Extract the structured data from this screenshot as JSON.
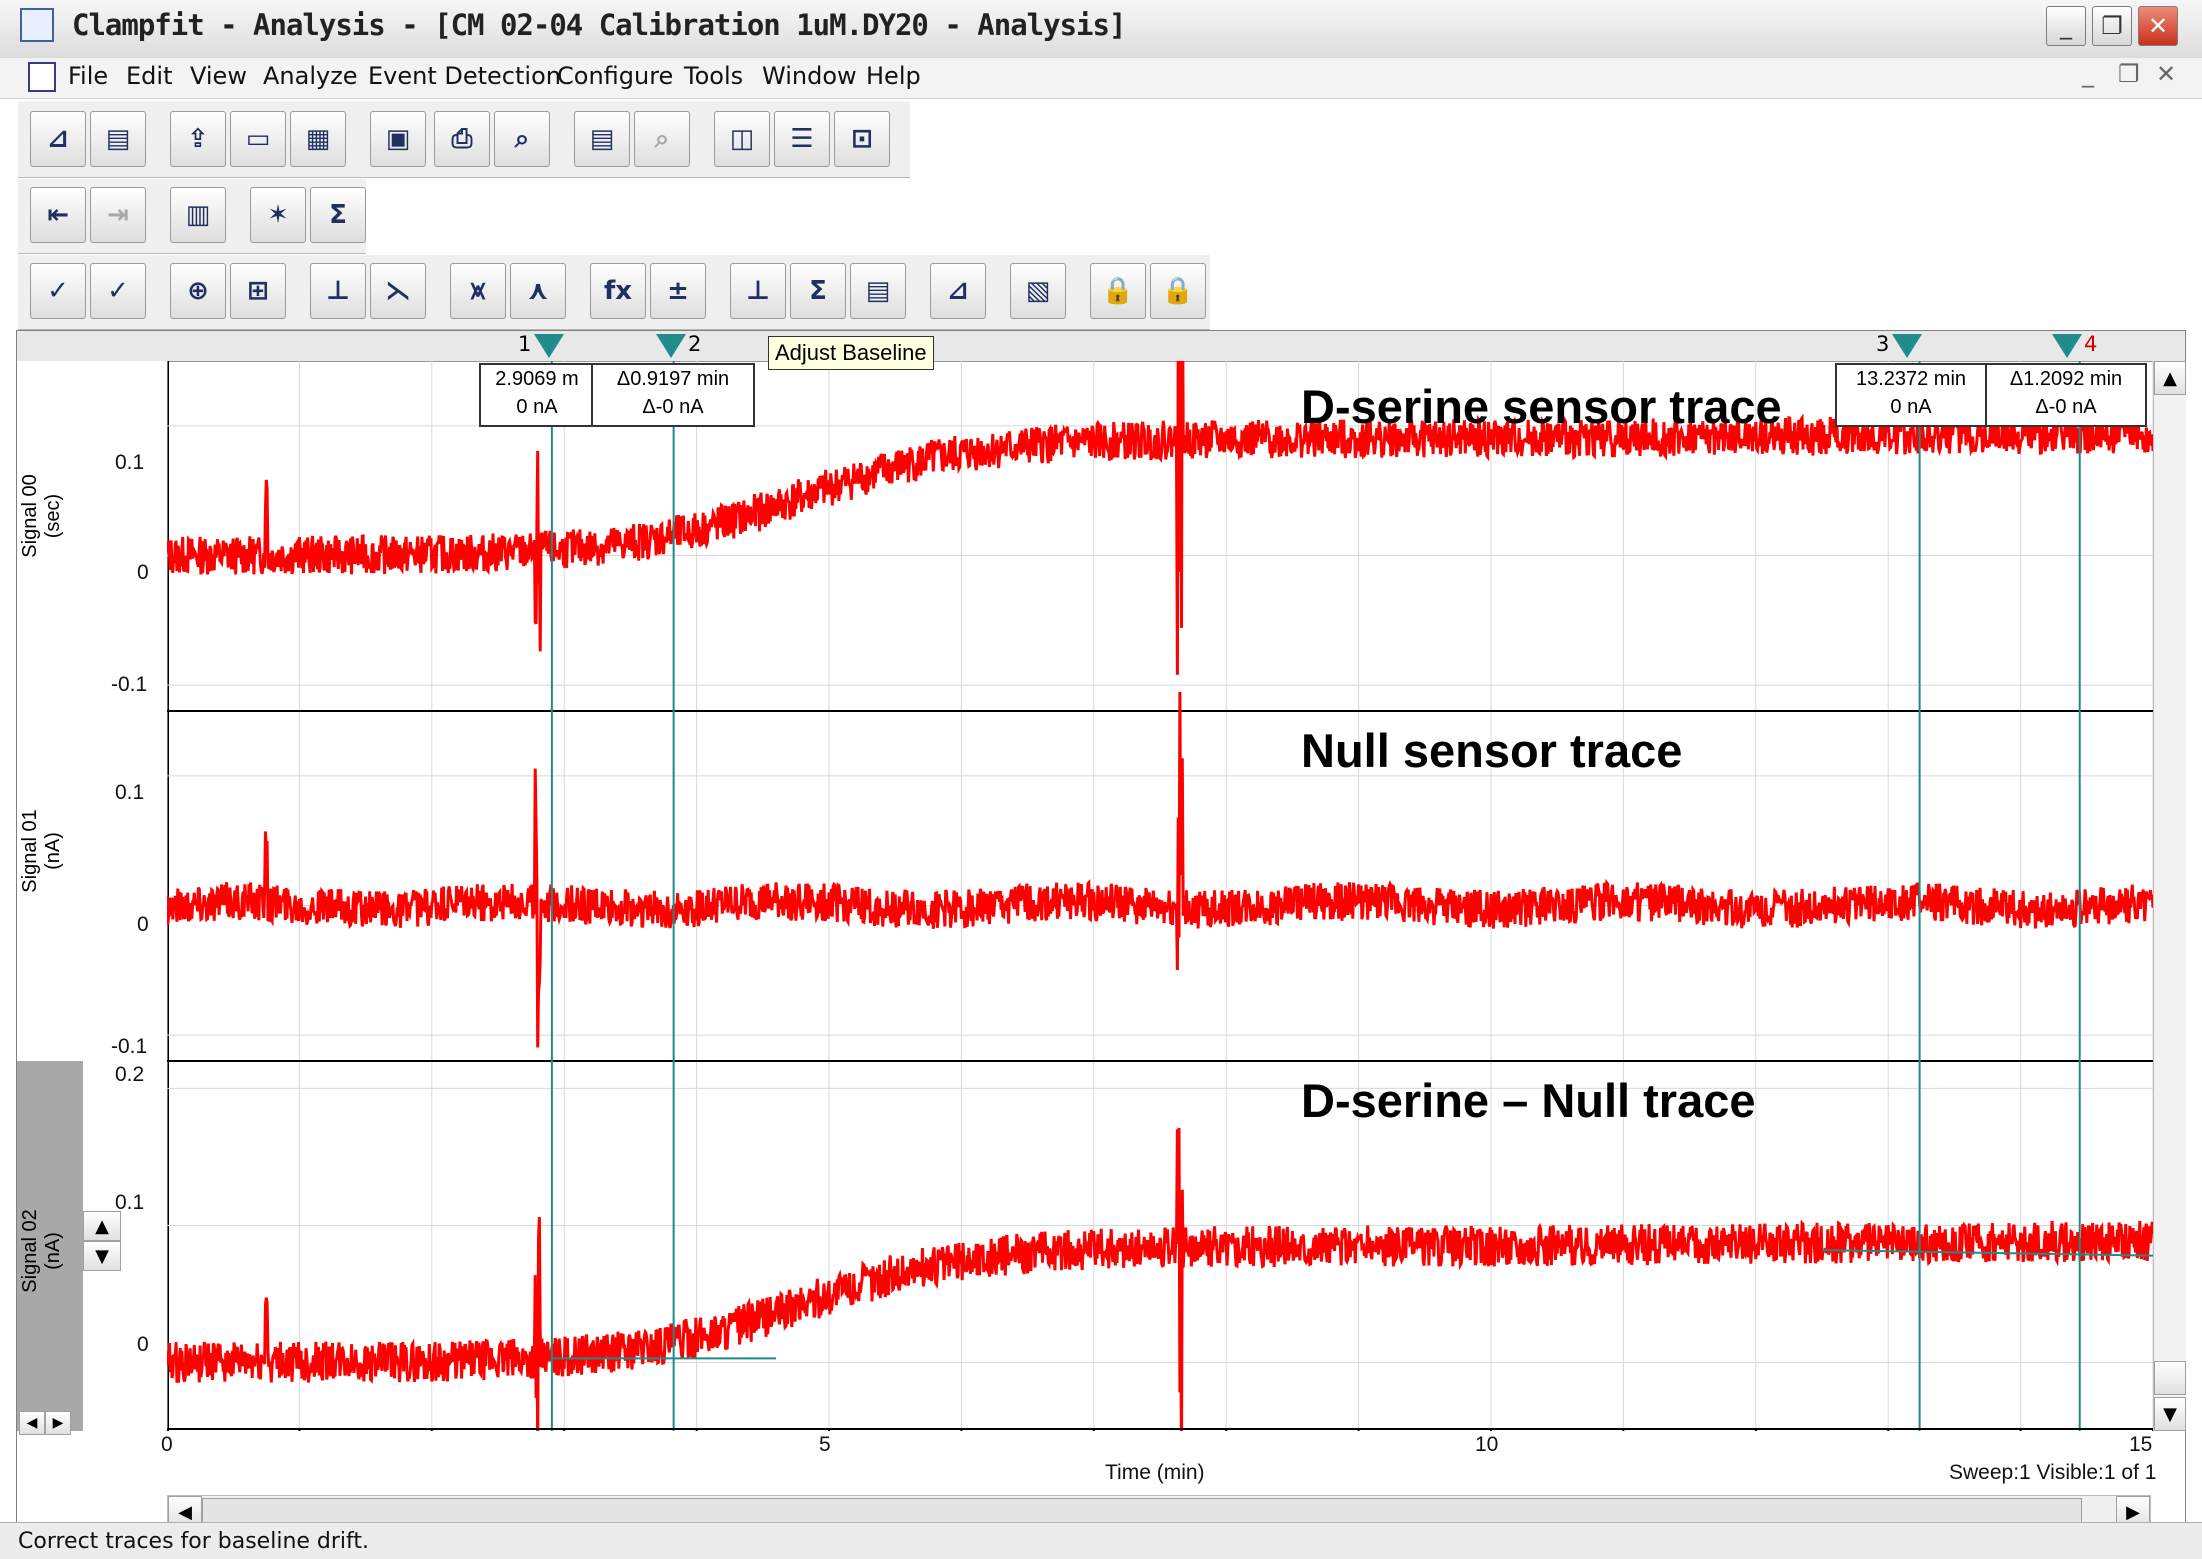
{
  "window": {
    "title": "Clampfit - Analysis - [CM 02-04 Calibration 1uM.DY20 - Analysis]",
    "icon": "clampfit-app-icon"
  },
  "menu": [
    "File",
    "Edit",
    "View",
    "Analyze",
    "Event Detection",
    "Configure",
    "Tools",
    "Window",
    "Help"
  ],
  "tooltip": "Adjust Baseline",
  "cursors": [
    {
      "num": "1",
      "time_min": 2.9069
    },
    {
      "num": "2",
      "time_min": 3.8266
    },
    {
      "num": "3",
      "time_min": 13.2372
    },
    {
      "num": "4",
      "time_min": 14.4464
    }
  ],
  "readouts": {
    "c1": {
      "line1": "2.9069 m",
      "line2": "0 nA"
    },
    "c2": {
      "line1": "Δ0.9197 min",
      "line2": "Δ-0 nA"
    },
    "c3": {
      "line1": "13.2372 min",
      "line2": "0 nA"
    },
    "c4": {
      "line1": "Δ1.2092 min",
      "line2": "Δ-0 nA"
    }
  },
  "panels": [
    {
      "signal": "Signal 00",
      "unit": "(sec)",
      "title": "D-serine sensor trace",
      "ticks": [
        "0.1",
        "0",
        "-0.1"
      ]
    },
    {
      "signal": "Signal 01",
      "unit": "(nA)",
      "title": "Null sensor trace",
      "ticks": [
        "0.1",
        "0",
        "-0.1"
      ]
    },
    {
      "signal": "Signal 02",
      "unit": "(nA)",
      "title": "D-serine – Null trace",
      "ticks": [
        "0.2",
        "0.1",
        "0"
      ]
    }
  ],
  "x_axis": {
    "label": "Time (min)",
    "ticks": [
      "0",
      "5",
      "10",
      "15"
    ],
    "range": [
      0,
      15
    ]
  },
  "sweep_info": "Sweep:1 Visible:1 of 1",
  "status": "Correct traces for baseline drift.",
  "colors": {
    "trace": "#ff0000",
    "cursor": "#1f8a8a"
  }
}
